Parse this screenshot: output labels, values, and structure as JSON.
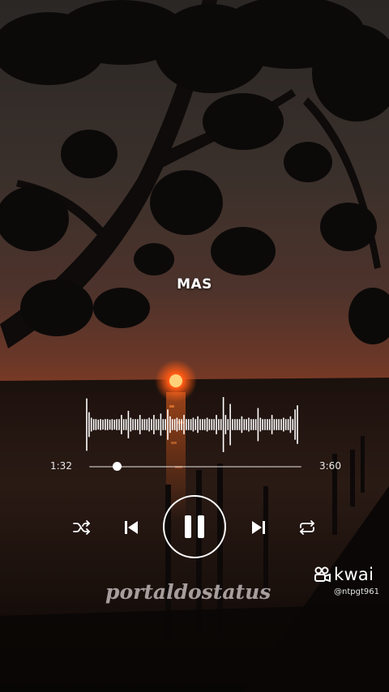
{
  "lyric": {
    "text": "MAS"
  },
  "player": {
    "current_time": "1:32",
    "total_time": "3:60",
    "progress": 0.13,
    "controls": {
      "shuffle_icon": "shuffle-icon",
      "prev_icon": "skip-previous-icon",
      "play_icon": "pause-icon",
      "next_icon": "skip-next-icon",
      "repeat_icon": "repeat-icon"
    },
    "waveform_levels": [
      0.95,
      0.45,
      0.25,
      0.2,
      0.2,
      0.18,
      0.2,
      0.18,
      0.2,
      0.2,
      0.18,
      0.2,
      0.18,
      0.2,
      0.2,
      0.35,
      0.2,
      0.2,
      0.5,
      0.25,
      0.2,
      0.2,
      0.2,
      0.35,
      0.2,
      0.2,
      0.2,
      0.25,
      0.2,
      0.35,
      0.2,
      0.2,
      0.4,
      0.2,
      0.2,
      0.55,
      0.3,
      0.2,
      0.2,
      0.25,
      0.2,
      0.2,
      0.35,
      0.2,
      0.2,
      0.2,
      0.25,
      0.2,
      0.3,
      0.2,
      0.2,
      0.2,
      0.25,
      0.2,
      0.2,
      0.2,
      0.35,
      0.2,
      0.2,
      1.0,
      0.35,
      0.2,
      0.75,
      0.2,
      0.2,
      0.2,
      0.2,
      0.3,
      0.2,
      0.2,
      0.25,
      0.2,
      0.2,
      0.2,
      0.6,
      0.25,
      0.2,
      0.2,
      0.2,
      0.2,
      0.35,
      0.2,
      0.2,
      0.2,
      0.2,
      0.25,
      0.2,
      0.2,
      0.3,
      0.2,
      0.55,
      0.7
    ]
  },
  "watermark": {
    "text": "portaldostatus"
  },
  "kwai": {
    "brand": "kwai",
    "handle": "@ntpgt961",
    "logo_icon": "kwai-logo-icon"
  },
  "colors": {
    "accent": "#ffffff",
    "sun": "#ff5a14",
    "sky_top": "#2b2826",
    "sky_glow": "#5a3224"
  }
}
